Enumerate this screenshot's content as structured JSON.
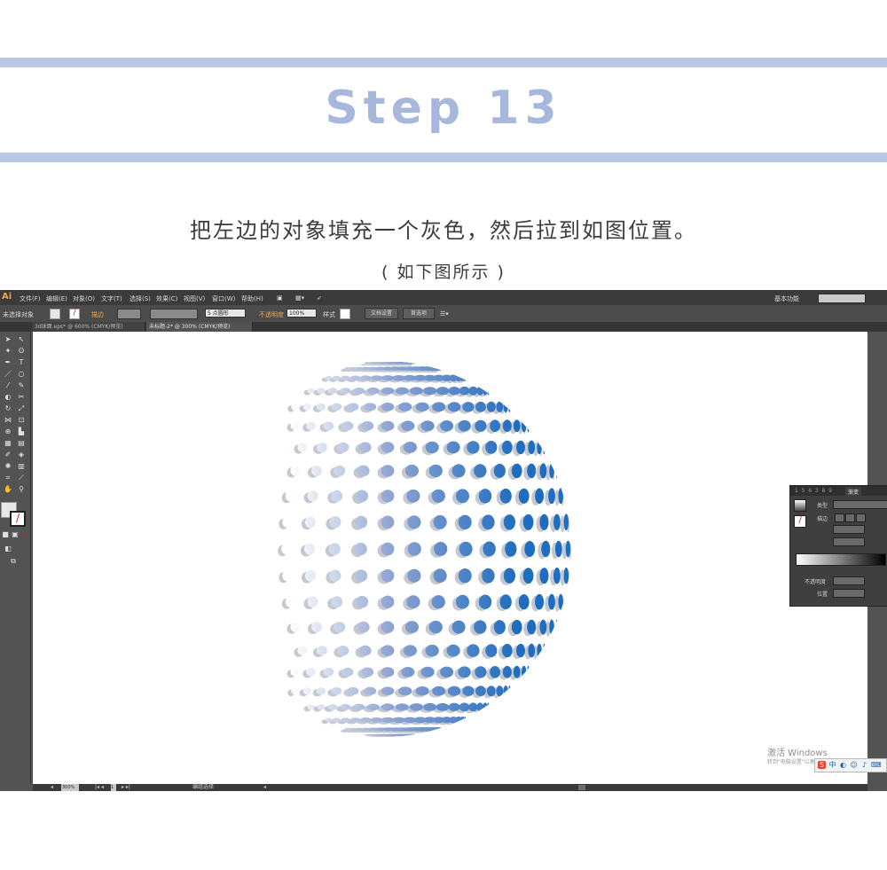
{
  "header": {
    "step_title": "Step 13",
    "instruction": "把左边的对象填充一个灰色，然后拉到如图位置。",
    "caption": "( 如下图所示 )"
  },
  "colors": {
    "band": "#b8c7e3",
    "title": "#a7b8dc",
    "sphere_gray_dots": "#c5c9cf",
    "sphere_gradient_light": "#ffffff",
    "sphere_gradient_mid": "#7f97cc",
    "sphere_gradient_dark": "#1f6dc0"
  },
  "app": {
    "logo": "Ai",
    "menu": [
      "文件(F)",
      "编辑(E)",
      "对象(O)",
      "文字(T)",
      "选择(S)",
      "效果(C)",
      "视图(V)",
      "窗口(W)",
      "帮助(H)"
    ],
    "workspace": "基本功能"
  },
  "control_bar": {
    "selection": "未选择对象",
    "stroke_label": "描边",
    "points": "5 点圆形",
    "opacity_label": "不透明度",
    "opacity_value": "100%",
    "style_label": "样式",
    "doc_setup": "文档设置",
    "preferences": "首选项"
  },
  "tabs": [
    {
      "label": "3d球面.eps* @ 600% (CMYK/预览)"
    },
    {
      "label": "未标题-2* @ 300% (CMYK/预览)"
    }
  ],
  "gradient_panel": {
    "tab": "渐变",
    "type_label": "类型",
    "stroke_label": "描边",
    "opacity_label": "不透明度",
    "location_label": "位置"
  },
  "status": {
    "zoom": "300%",
    "page": "1",
    "mode": "编组选择"
  },
  "watermark": {
    "title": "激活 Windows",
    "subtitle": "转到\"电脑设置\"以激活 Windows。"
  },
  "ime": {
    "logo": "S",
    "lang": "中"
  }
}
